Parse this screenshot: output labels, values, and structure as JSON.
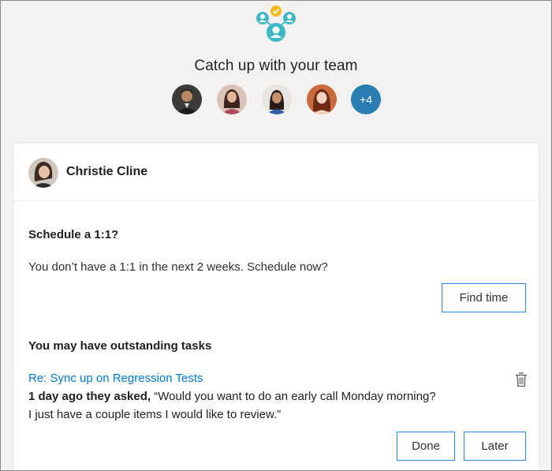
{
  "header": {
    "title": "Catch up with your team",
    "more_count": "+4"
  },
  "person": {
    "name": "Christie Cline"
  },
  "schedule": {
    "title": "Schedule a 1:1?",
    "message": "You don’t have a 1:1 in the next 2 weeks. Schedule now?",
    "button": "Find time"
  },
  "tasks": {
    "title": "You may have outstanding tasks",
    "link": "Re: Sync up on Regression Tests",
    "asked_prefix": "1 day ago they asked,",
    "quote_line1": " “Would you want to do an early call Monday morning?",
    "quote_line2": "I just have a couple items I would like to review.”",
    "done_button": "Done",
    "later_button": "Later"
  },
  "colors": {
    "accent": "#2b88d8",
    "link": "#0078d4",
    "badge": "#2a7db0",
    "logo_teal": "#3fb8c5",
    "logo_yellow": "#f2b81c"
  }
}
